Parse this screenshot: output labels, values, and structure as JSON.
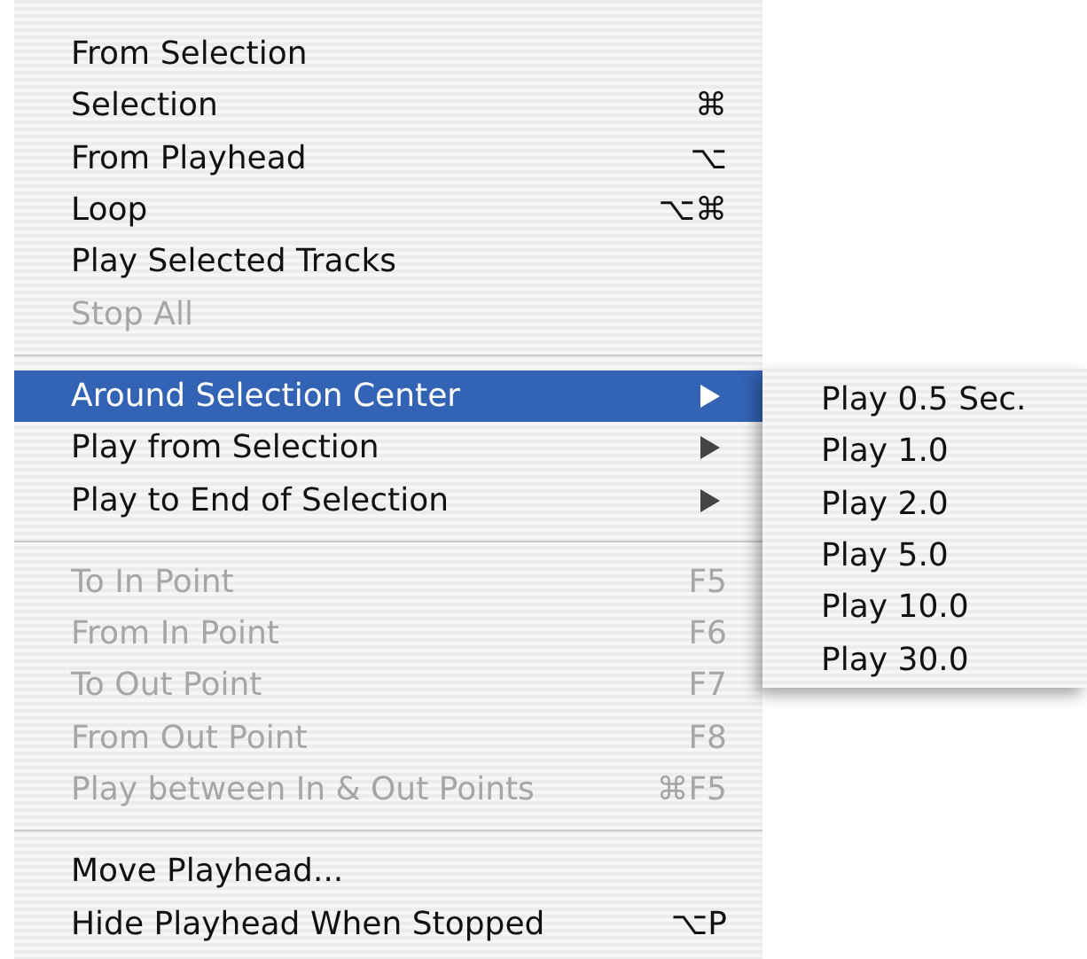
{
  "menu": {
    "items": [
      {
        "kind": "item",
        "label": "From Selection",
        "disabled": false,
        "selected": false,
        "submenu": false
      },
      {
        "kind": "item",
        "label": "Selection",
        "shortcut": "⌘",
        "disabled": false,
        "selected": false,
        "submenu": false
      },
      {
        "kind": "item",
        "label": "From Playhead",
        "shortcut": "⌥",
        "disabled": false,
        "selected": false,
        "submenu": false
      },
      {
        "kind": "item",
        "label": "Loop",
        "shortcut": "⌥⌘",
        "disabled": false,
        "selected": false,
        "submenu": false
      },
      {
        "kind": "item",
        "label": "Play Selected Tracks",
        "disabled": false,
        "selected": false,
        "submenu": false
      },
      {
        "kind": "item",
        "label": "Stop All",
        "disabled": true,
        "selected": false,
        "submenu": false
      },
      {
        "kind": "separator"
      },
      {
        "kind": "item",
        "label": "Around Selection Center",
        "disabled": false,
        "selected": true,
        "submenu": true
      },
      {
        "kind": "item",
        "label": "Play from Selection",
        "disabled": false,
        "selected": false,
        "submenu": true
      },
      {
        "kind": "item",
        "label": "Play to End of Selection",
        "disabled": false,
        "selected": false,
        "submenu": true
      },
      {
        "kind": "separator"
      },
      {
        "kind": "item",
        "label": "To In Point",
        "shortcut": "F5",
        "disabled": true,
        "selected": false,
        "submenu": false
      },
      {
        "kind": "item",
        "label": "From In Point",
        "shortcut": "F6",
        "disabled": true,
        "selected": false,
        "submenu": false
      },
      {
        "kind": "item",
        "label": "To Out Point",
        "shortcut": "F7",
        "disabled": true,
        "selected": false,
        "submenu": false
      },
      {
        "kind": "item",
        "label": "From Out Point",
        "shortcut": "F8",
        "disabled": true,
        "selected": false,
        "submenu": false
      },
      {
        "kind": "item",
        "label": "Play between In & Out Points",
        "shortcut": "⌘F5",
        "disabled": true,
        "selected": false,
        "submenu": false
      },
      {
        "kind": "separator"
      },
      {
        "kind": "item",
        "label": "Move Playhead...",
        "disabled": false,
        "selected": false,
        "submenu": false
      },
      {
        "kind": "item",
        "label": "Hide Playhead When Stopped",
        "shortcut": "⌥P",
        "disabled": false,
        "selected": false,
        "submenu": false
      }
    ]
  },
  "submenu": {
    "items": [
      {
        "label": "Play 0.5 Sec."
      },
      {
        "label": "Play 1.0"
      },
      {
        "label": "Play 2.0"
      },
      {
        "label": "Play 5.0"
      },
      {
        "label": "Play 10.0"
      },
      {
        "label": "Play 30.0"
      }
    ]
  }
}
